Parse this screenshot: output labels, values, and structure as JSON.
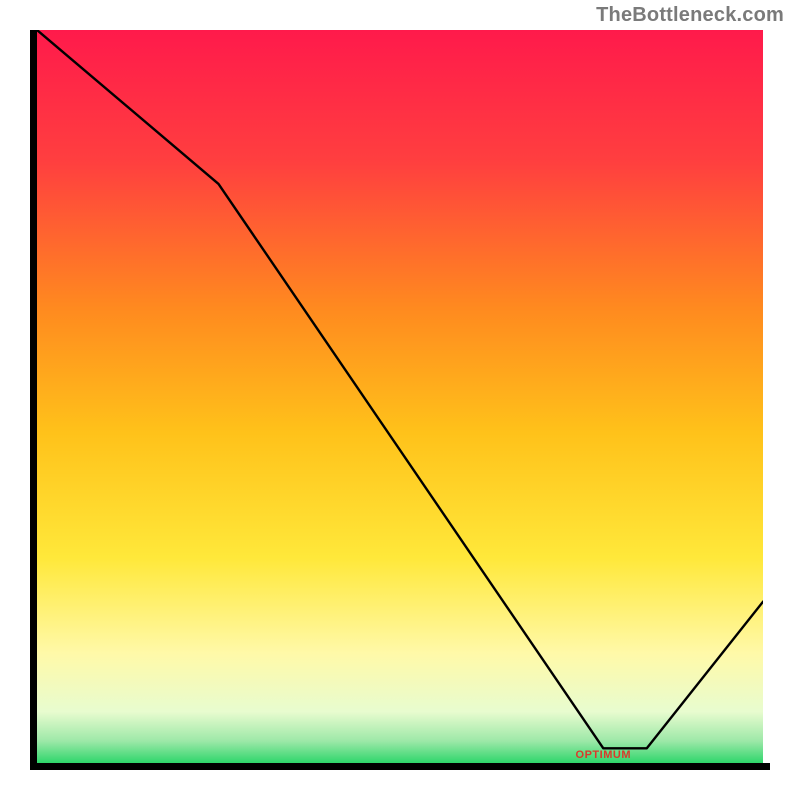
{
  "watermark": "TheBottleneck.com",
  "chart_data": {
    "type": "line",
    "title": "",
    "xlabel": "",
    "ylabel": "",
    "xlim": [
      0,
      100
    ],
    "ylim": [
      0,
      100
    ],
    "x": [
      0,
      25,
      78,
      84,
      100
    ],
    "values": [
      100,
      79,
      2,
      2,
      22
    ],
    "x_annotation": {
      "x": 78,
      "text": "OPTIMUM"
    },
    "gradient_stops": [
      {
        "offset": 0.0,
        "color": "#ff1a4b"
      },
      {
        "offset": 0.18,
        "color": "#ff3f3f"
      },
      {
        "offset": 0.38,
        "color": "#ff8a1f"
      },
      {
        "offset": 0.55,
        "color": "#ffc21a"
      },
      {
        "offset": 0.72,
        "color": "#ffe83a"
      },
      {
        "offset": 0.85,
        "color": "#fff9a8"
      },
      {
        "offset": 0.93,
        "color": "#e8fccf"
      },
      {
        "offset": 0.97,
        "color": "#9de8a8"
      },
      {
        "offset": 1.0,
        "color": "#2fd66b"
      }
    ]
  }
}
